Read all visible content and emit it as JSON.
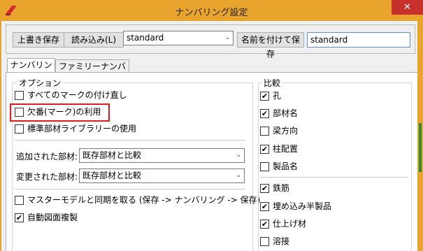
{
  "window": {
    "title": "ナンバリング設定",
    "close_glyph": "✕"
  },
  "toolbar": {
    "overwrite_save_label": "上書き保存",
    "load_label": "読み込み(L)",
    "preset_selected": "standard",
    "save_as_label": "名前を付けて保存",
    "save_as_name": "standard"
  },
  "tabs": [
    {
      "label": "ナンバリング",
      "active": true
    },
    {
      "label": "ファミリーナンバリング",
      "active": false
    }
  ],
  "options": {
    "group_label": "オプション",
    "checkboxes": [
      {
        "label": "すべてのマークの付け直し",
        "checked": false
      },
      {
        "label": "欠番(マーク)の利用",
        "checked": false
      },
      {
        "label": "標準部材ライブラリーの使用",
        "checked": false
      }
    ],
    "added_parts_label": "追加された部材:",
    "added_parts_value": "既存部材と比較",
    "changed_parts_label": "変更された部材:",
    "changed_parts_value": "既存部材と比較",
    "bottom_checkboxes": [
      {
        "label": "マスターモデルと同期を取る (保存 -> ナンバリング -> 保存)",
        "checked": false
      },
      {
        "label": "自動図面複製",
        "checked": true
      }
    ]
  },
  "compare": {
    "group_label": "比較",
    "items_top": [
      {
        "label": "孔",
        "checked": true
      },
      {
        "label": "部材名",
        "checked": true
      },
      {
        "label": "梁方向",
        "checked": false
      },
      {
        "label": "柱配置",
        "checked": true
      },
      {
        "label": "製品名",
        "checked": false
      }
    ],
    "items_bottom": [
      {
        "label": "鉄筋",
        "checked": true
      },
      {
        "label": "埋め込み半製品",
        "checked": true
      },
      {
        "label": "仕上げ材",
        "checked": true
      },
      {
        "label": "溶接",
        "checked": false
      }
    ]
  },
  "check_glyph": "✔",
  "dropdown_arrow_glyph": "⌄",
  "accent_color": "#e8a42c",
  "highlight_color": "#e11b22"
}
